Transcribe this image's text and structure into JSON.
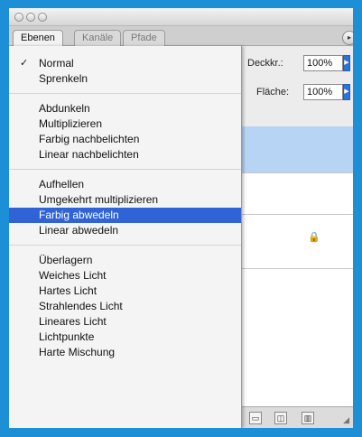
{
  "tabs": [
    "Ebenen",
    "Kanäle",
    "Pfade"
  ],
  "panel": {
    "opacity_label": "Deckkr.:",
    "opacity_value": "100%",
    "fill_label": "Fläche:",
    "fill_value": "100%"
  },
  "menu": {
    "groups": [
      [
        {
          "label": "Normal",
          "checked": true
        },
        {
          "label": "Sprenkeln"
        }
      ],
      [
        {
          "label": "Abdunkeln"
        },
        {
          "label": "Multiplizieren"
        },
        {
          "label": "Farbig nachbelichten"
        },
        {
          "label": "Linear nachbelichten"
        }
      ],
      [
        {
          "label": "Aufhellen"
        },
        {
          "label": "Umgekehrt multiplizieren"
        },
        {
          "label": "Farbig abwedeln",
          "selected": true
        },
        {
          "label": "Linear abwedeln"
        }
      ],
      [
        {
          "label": "Überlagern"
        },
        {
          "label": "Weiches Licht"
        },
        {
          "label": "Hartes Licht"
        },
        {
          "label": "Strahlendes Licht"
        },
        {
          "label": "Lineares Licht"
        },
        {
          "label": "Lichtpunkte"
        },
        {
          "label": "Harte Mischung"
        }
      ]
    ],
    "check_glyph": "✓"
  },
  "icons": {
    "panel_options": "panel-options-icon",
    "lock": "lock-icon",
    "new_set": "folder-icon",
    "new_layer": "new-layer-icon",
    "trash": "trash-icon",
    "resize": "resize-grip-icon"
  },
  "colors": {
    "frame": "#1c8fd6",
    "selection": "#2f63d6",
    "layer_highlight": "#b8d4f5"
  }
}
